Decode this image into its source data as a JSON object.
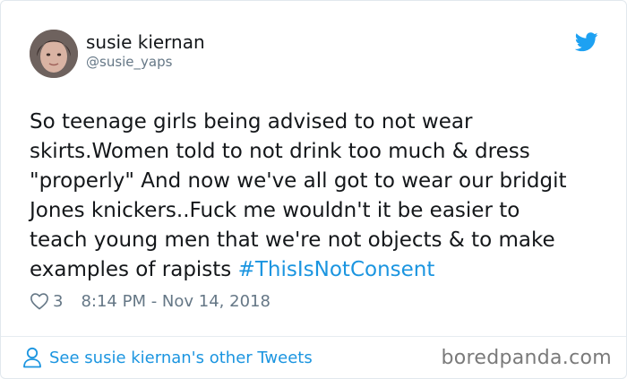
{
  "author": {
    "name": "susie kiernan",
    "handle": "@susie_yaps"
  },
  "tweet": {
    "text_before": "So teenage girls being advised to not wear\nskirts.Women told to not drink too much & dress\n\"properly\" And now we've all got to wear our bridgit\nJones knickers..Fuck me wouldn't it be easier to\nteach young men that we're not objects & to make\nexamples of rapists ",
    "hashtag": "#ThisIsNotConsent"
  },
  "meta": {
    "like_count": "3",
    "timestamp": "8:14 PM - Nov 14, 2018"
  },
  "footer": {
    "other_tweets_link": "See susie kiernan's other Tweets",
    "watermark": "boredpanda.com"
  },
  "icons": {
    "brand": "twitter-bird-icon",
    "like": "heart-icon",
    "profile": "person-icon"
  },
  "colors": {
    "link": "#1b95e0",
    "text": "#14171a",
    "muted": "#657786"
  }
}
